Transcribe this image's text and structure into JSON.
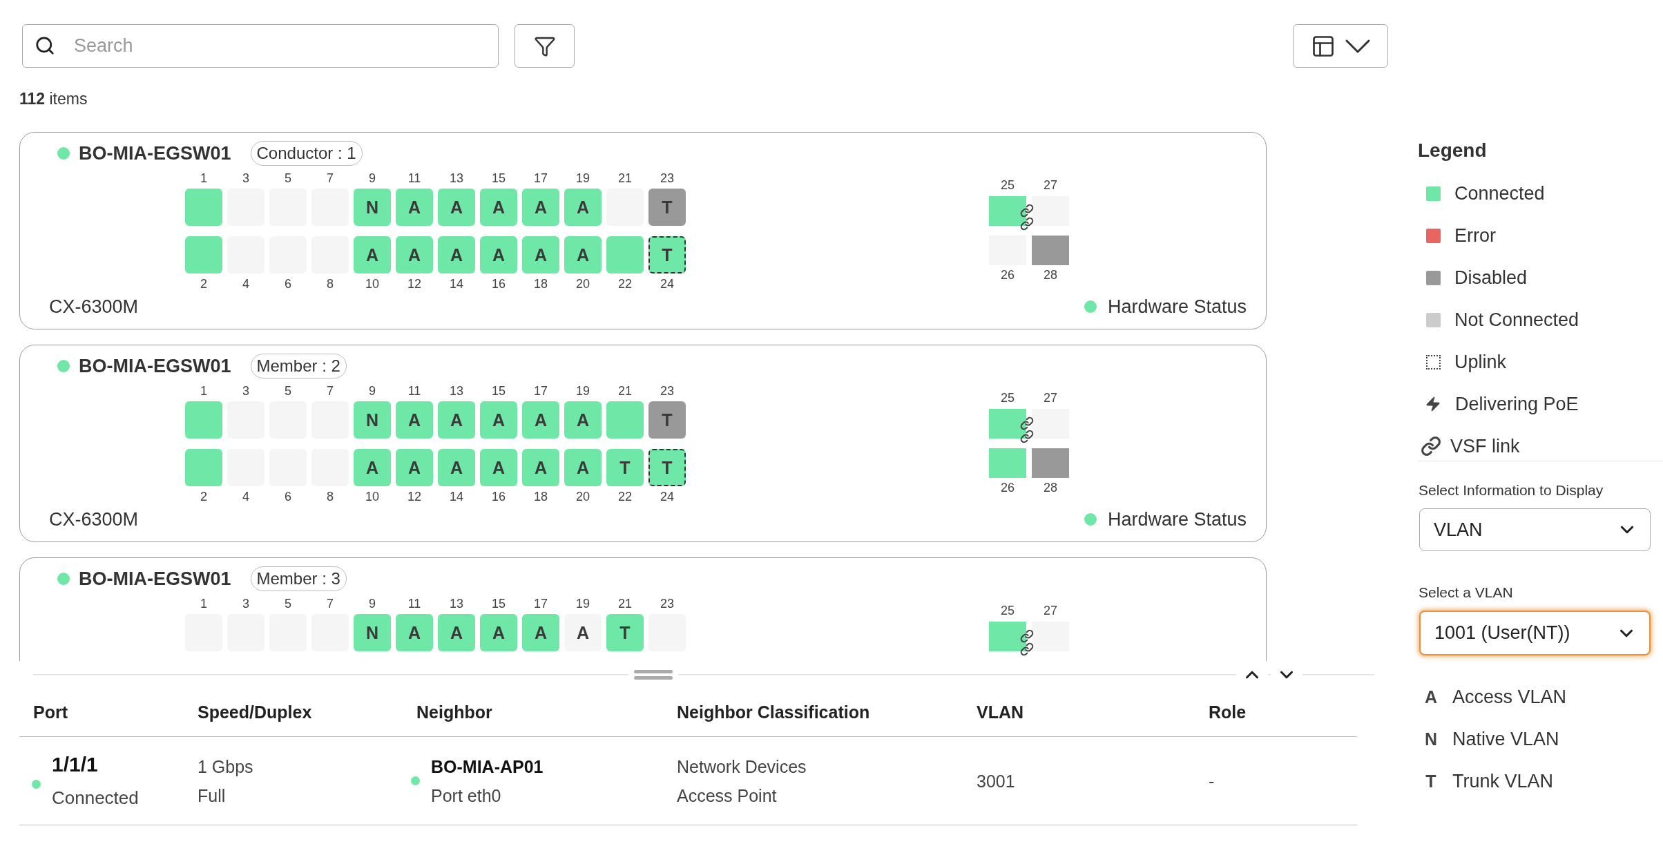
{
  "search": {
    "placeholder": "Search"
  },
  "count": "**112** items",
  "cards": [
    {
      "name": "BO-MIA-EGSW01",
      "online": true,
      "role": "Conductor : 1",
      "model": "CX-6300M",
      "hardware_status": "Hardware Status",
      "hardware_ok": true,
      "vsf_link": true,
      "top_row": [
        {
          "number": "1",
          "color": "#6ee7a7",
          "uplink": false
        },
        {
          "number": "3",
          "color": "#f5f5f5",
          "uplink": false
        },
        {
          "number": "5",
          "color": "#f5f5f5",
          "uplink": false
        },
        {
          "number": "7",
          "color": "#f5f5f5",
          "uplink": false
        },
        {
          "number": "9",
          "color": "#6ee7a7",
          "vlan": "N",
          "uplink": false
        },
        {
          "number": "11",
          "color": "#6ee7a7",
          "vlan": "A",
          "uplink": false
        },
        {
          "number": "13",
          "color": "#6ee7a7",
          "vlan": "A",
          "uplink": false
        },
        {
          "number": "15",
          "color": "#6ee7a7",
          "vlan": "A",
          "uplink": false
        },
        {
          "number": "17",
          "color": "#6ee7a7",
          "vlan": "A",
          "uplink": false
        },
        {
          "number": "19",
          "color": "#6ee7a7",
          "vlan": "A",
          "uplink": false
        },
        {
          "number": "21",
          "color": "#f5f5f5",
          "uplink": false
        },
        {
          "number": "23",
          "color": "#999999",
          "vlan": "T",
          "uplink": false
        }
      ],
      "bottom_row": [
        {
          "number": "2",
          "color": "#6ee7a7",
          "uplink": false
        },
        {
          "number": "4",
          "color": "#f5f5f5",
          "uplink": false
        },
        {
          "number": "6",
          "color": "#f5f5f5",
          "uplink": false
        },
        {
          "number": "8",
          "color": "#f5f5f5",
          "uplink": false
        },
        {
          "number": "10",
          "color": "#6ee7a7",
          "vlan": "A",
          "uplink": false
        },
        {
          "number": "12",
          "color": "#6ee7a7",
          "vlan": "A",
          "uplink": false
        },
        {
          "number": "14",
          "color": "#6ee7a7",
          "vlan": "A",
          "uplink": false
        },
        {
          "number": "16",
          "color": "#6ee7a7",
          "vlan": "A",
          "uplink": false
        },
        {
          "number": "18",
          "color": "#6ee7a7",
          "vlan": "A",
          "uplink": false
        },
        {
          "number": "20",
          "color": "#6ee7a7",
          "vlan": "A",
          "uplink": false
        },
        {
          "number": "22",
          "color": "#6ee7a7",
          "uplink": false
        },
        {
          "number": "24",
          "color": "#6ee7a7",
          "vlan": "T",
          "uplink": true
        }
      ],
      "stack_top": [
        {
          "number": "25",
          "color": "#6ee7a7"
        },
        {
          "number": "27",
          "color": "#f5f5f5"
        }
      ],
      "stack_bottom": [
        {
          "number": "26",
          "color": "#f5f5f5"
        },
        {
          "number": "28",
          "color": "#999999"
        }
      ]
    },
    {
      "name": "BO-MIA-EGSW01",
      "online": true,
      "role": "Member : 2",
      "model": "CX-6300M",
      "hardware_status": "Hardware Status",
      "hardware_ok": true,
      "vsf_link": true,
      "top_row": [
        {
          "number": "1",
          "color": "#6ee7a7",
          "uplink": false
        },
        {
          "number": "3",
          "color": "#f5f5f5",
          "uplink": false
        },
        {
          "number": "5",
          "color": "#f5f5f5",
          "uplink": false
        },
        {
          "number": "7",
          "color": "#f5f5f5",
          "uplink": false
        },
        {
          "number": "9",
          "color": "#6ee7a7",
          "vlan": "N",
          "uplink": false
        },
        {
          "number": "11",
          "color": "#6ee7a7",
          "vlan": "A",
          "uplink": false
        },
        {
          "number": "13",
          "color": "#6ee7a7",
          "vlan": "A",
          "uplink": false
        },
        {
          "number": "15",
          "color": "#6ee7a7",
          "vlan": "A",
          "uplink": false
        },
        {
          "number": "17",
          "color": "#6ee7a7",
          "vlan": "A",
          "uplink": false
        },
        {
          "number": "19",
          "color": "#6ee7a7",
          "vlan": "A",
          "uplink": false
        },
        {
          "number": "21",
          "color": "#6ee7a7",
          "uplink": false
        },
        {
          "number": "23",
          "color": "#999999",
          "vlan": "T",
          "uplink": false
        }
      ],
      "bottom_row": [
        {
          "number": "2",
          "color": "#6ee7a7",
          "uplink": false
        },
        {
          "number": "4",
          "color": "#f5f5f5",
          "uplink": false
        },
        {
          "number": "6",
          "color": "#f5f5f5",
          "uplink": false
        },
        {
          "number": "8",
          "color": "#f5f5f5",
          "uplink": false
        },
        {
          "number": "10",
          "color": "#6ee7a7",
          "vlan": "A",
          "uplink": false
        },
        {
          "number": "12",
          "color": "#6ee7a7",
          "vlan": "A",
          "uplink": false
        },
        {
          "number": "14",
          "color": "#6ee7a7",
          "vlan": "A",
          "uplink": false
        },
        {
          "number": "16",
          "color": "#6ee7a7",
          "vlan": "A",
          "uplink": false
        },
        {
          "number": "18",
          "color": "#6ee7a7",
          "vlan": "A",
          "uplink": false
        },
        {
          "number": "20",
          "color": "#6ee7a7",
          "vlan": "A",
          "uplink": false
        },
        {
          "number": "22",
          "color": "#6ee7a7",
          "vlan": "T",
          "uplink": false
        },
        {
          "number": "24",
          "color": "#6ee7a7",
          "vlan": "T",
          "uplink": true
        }
      ],
      "stack_top": [
        {
          "number": "25",
          "color": "#6ee7a7"
        },
        {
          "number": "27",
          "color": "#f5f5f5"
        }
      ],
      "stack_bottom": [
        {
          "number": "26",
          "color": "#6ee7a7"
        },
        {
          "number": "28",
          "color": "#999999"
        }
      ]
    },
    {
      "name": "BO-MIA-EGSW01",
      "online": true,
      "role": "Member : 3",
      "vsf_link": true,
      "top_row": [
        {
          "number": "1",
          "color": "#f5f5f5",
          "uplink": false
        },
        {
          "number": "3",
          "color": "#f5f5f5",
          "uplink": false
        },
        {
          "number": "5",
          "color": "#f5f5f5",
          "uplink": false
        },
        {
          "number": "7",
          "color": "#f5f5f5",
          "uplink": false
        },
        {
          "number": "9",
          "color": "#6ee7a7",
          "vlan": "N",
          "uplink": false
        },
        {
          "number": "11",
          "color": "#6ee7a7",
          "vlan": "A",
          "uplink": false
        },
        {
          "number": "13",
          "color": "#6ee7a7",
          "vlan": "A",
          "uplink": false
        },
        {
          "number": "15",
          "color": "#6ee7a7",
          "vlan": "A",
          "uplink": false
        },
        {
          "number": "17",
          "color": "#6ee7a7",
          "vlan": "A",
          "uplink": false
        },
        {
          "number": "19",
          "color": "#f5f5f5",
          "vlan": "A",
          "uplink": false
        },
        {
          "number": "21",
          "color": "#6ee7a7",
          "vlan": "T",
          "uplink": false
        },
        {
          "number": "23",
          "color": "#f5f5f5",
          "uplink": false
        }
      ],
      "stack_top": [
        {
          "number": "25",
          "color": "#6ee7a7"
        },
        {
          "number": "27",
          "color": "#f5f5f5"
        }
      ]
    }
  ],
  "table": {
    "columns": [
      "Port",
      "Speed/Duplex",
      "Neighbor",
      "Neighbor Classification",
      "VLAN",
      "Role"
    ],
    "rows": [
      {
        "port": "1/1/1",
        "port_status": "Connected",
        "online": true,
        "speed": "1 Gbps",
        "duplex": "Full",
        "neighbor": "BO-MIA-AP01",
        "neighbor_port": "Port eth0",
        "neighbor_online": true,
        "classification": "Network Devices",
        "classification_type": "Access Point",
        "vlan": "3001",
        "role": "-"
      }
    ]
  },
  "legend": {
    "title": "Legend",
    "items": [
      {
        "kind": "swatch",
        "label": "Connected",
        "color": "#6ee7a7"
      },
      {
        "kind": "swatch",
        "label": "Error",
        "color": "#e8665f"
      },
      {
        "kind": "swatch",
        "label": "Disabled",
        "color": "#999999"
      },
      {
        "kind": "swatch",
        "label": "Not Connected",
        "color": "#cccccc"
      },
      {
        "kind": "uplink",
        "label": "Uplink"
      },
      {
        "kind": "poe",
        "label": "Delivering PoE"
      },
      {
        "kind": "vsf",
        "label": "VSF link"
      }
    ]
  },
  "display_select": {
    "label": "Select Information to Display",
    "value": "VLAN",
    "focused": false
  },
  "vlan_select": {
    "label": "Select a VLAN",
    "value": "1001 (User(NT))",
    "focused": true
  },
  "vlan_legend": [
    {
      "letter": "A",
      "label": "Access VLAN"
    },
    {
      "letter": "N",
      "label": "Native VLAN"
    },
    {
      "letter": "T",
      "label": "Trunk VLAN"
    }
  ]
}
